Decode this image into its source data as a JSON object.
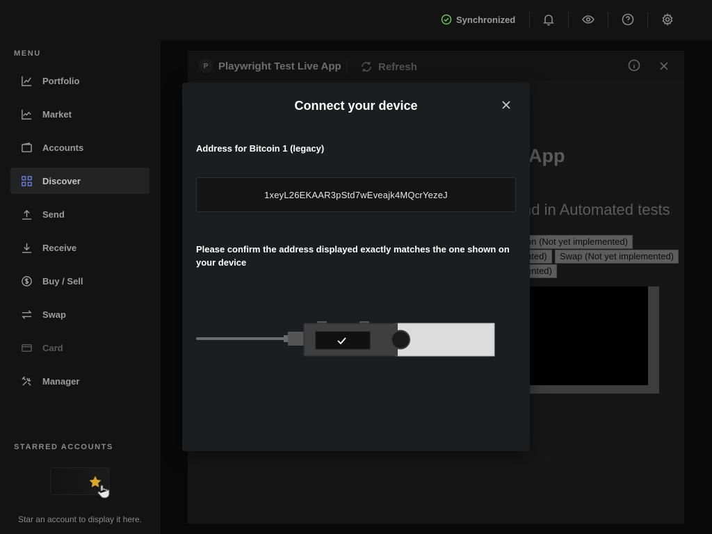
{
  "sidebar": {
    "menu_title": "MENU",
    "items": [
      {
        "label": "Portfolio",
        "icon": "portfolio-icon"
      },
      {
        "label": "Market",
        "icon": "market-icon"
      },
      {
        "label": "Accounts",
        "icon": "wallet-icon"
      },
      {
        "label": "Discover",
        "icon": "grid-icon"
      },
      {
        "label": "Send",
        "icon": "arrow-up-icon"
      },
      {
        "label": "Receive",
        "icon": "arrow-down-icon"
      },
      {
        "label": "Buy / Sell",
        "icon": "dollar-icon"
      },
      {
        "label": "Swap",
        "icon": "swap-icon"
      },
      {
        "label": "Card",
        "icon": "card-icon"
      },
      {
        "label": "Manager",
        "icon": "tools-icon"
      }
    ],
    "active_item": "Discover",
    "disabled_item": "Card",
    "starred_title": "STARRED ACCOUNTS",
    "starred_hint": "Star an account to display it here."
  },
  "topbar": {
    "sync_label": "Synchronized",
    "icons": [
      "bell-icon",
      "eye-icon",
      "help-icon",
      "settings-icon"
    ]
  },
  "live_app": {
    "avatar_letter": "P",
    "title": "Playwright Test Live App",
    "refresh_label": "Refresh",
    "heading_fragment": "App",
    "subheading_fragment": "nd in Automated tests",
    "buttons": [
      "on (Not yet implemented)",
      "nted)",
      "Swap (Not yet implemented)",
      "ented)"
    ]
  },
  "modal": {
    "title": "Connect your device",
    "address_label": "Address for Bitcoin 1 (legacy)",
    "address_value": "1xeyL26EKAAR3pStd7wEveajk4MQcrYezeJ",
    "confirm_text": "Please confirm the address displayed exactly matches the one shown on your device"
  },
  "colors": {
    "sync_green": "#6ec85c",
    "star_gold": "#d9a62e",
    "background": "#0f0f10",
    "modal": "#1c1d1f"
  }
}
